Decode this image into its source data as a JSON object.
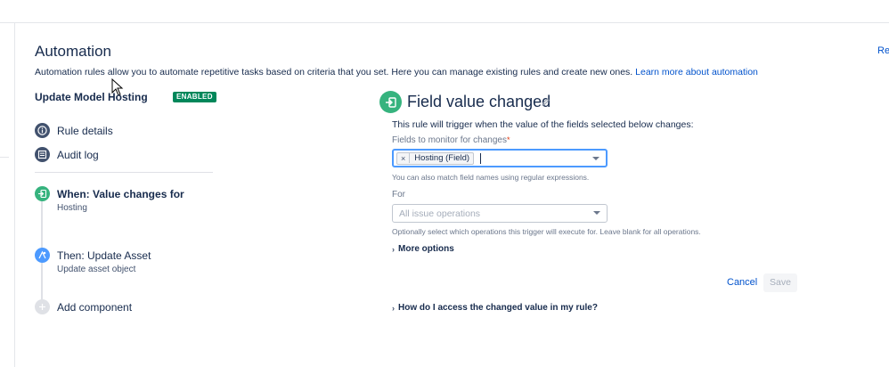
{
  "header": {
    "title": "Automation",
    "top_right_link": "Re",
    "description": "Automation rules allow you to automate repetitive tasks based on criteria that you set. Here you can manage existing rules and create new ones.",
    "learn_more": "Learn more about automation"
  },
  "rule": {
    "name": "Update Model Hosting",
    "status": "ENABLED"
  },
  "sidebar": {
    "items": [
      {
        "label": "Rule details",
        "icon": "info-icon"
      },
      {
        "label": "Audit log",
        "icon": "list-icon"
      }
    ],
    "steps": [
      {
        "title": "When: Value changes for",
        "sub": "Hosting",
        "icon": "trigger-icon",
        "color": "#36b37e"
      },
      {
        "title": "Then: Update Asset",
        "sub": "Update asset object",
        "icon": "asset-icon",
        "color": "#4c9aff"
      },
      {
        "title": "Add component",
        "icon": "plus-icon",
        "color": "#dfe1e6"
      }
    ]
  },
  "panel": {
    "title": "Field value changed",
    "intro": "This rule will trigger when the value of the fields selected below changes:",
    "fields_label": "Fields to monitor for changes",
    "fields_chip": "Hosting (Field)",
    "fields_help": "You can also match field names using regular expressions.",
    "for_label": "For",
    "for_placeholder": "All issue operations",
    "for_help": "Optionally select which operations this trigger will execute for. Leave blank for all operations.",
    "more_options": "More options",
    "cancel": "Cancel",
    "save": "Save",
    "faq": "How do I access the changed value in my rule?"
  },
  "colors": {
    "link": "#0052cc",
    "badge": "#00875a",
    "focus": "#4c9aff"
  }
}
